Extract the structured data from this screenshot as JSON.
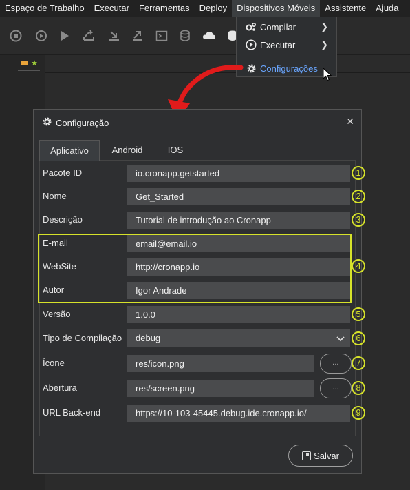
{
  "menubar": {
    "items": [
      "Espaço de Trabalho",
      "Executar",
      "Ferramentas",
      "Deploy",
      "Dispositivos Móveis",
      "Assistente",
      "Ajuda"
    ]
  },
  "toolbar": {
    "icons": [
      "stop-icon",
      "bug-icon",
      "play-icon",
      "export-icon",
      "import-icon",
      "share-icon",
      "terminal-icon",
      "database-icon",
      "cloud-icon",
      "database-cloud-icon"
    ]
  },
  "dropdown": {
    "compile": "Compilar",
    "execute": "Executar",
    "settings": "Configurações"
  },
  "dialog": {
    "title": "Configuração",
    "tabs": [
      "Aplicativo",
      "Android",
      "IOS"
    ],
    "fields": [
      {
        "label": "Pacote ID",
        "value": "io.cronapp.getstarted",
        "badge": "1"
      },
      {
        "label": "Nome",
        "value": "Get_Started",
        "badge": "2"
      },
      {
        "label": "Descrição",
        "value": "Tutorial de introdução ao Cronapp",
        "badge": "3"
      },
      {
        "label": "E-mail",
        "value": "email@email.io"
      },
      {
        "label": "WebSite",
        "value": "http://cronapp.io"
      },
      {
        "label": "Autor",
        "value": "Igor Andrade"
      },
      {
        "label": "Versão",
        "value": "1.0.0",
        "badge": "5"
      },
      {
        "label": "Tipo de Compilação",
        "value": "debug",
        "badge": "6"
      },
      {
        "label": "Ícone",
        "value": "res/icon.png",
        "badge": "7"
      },
      {
        "label": "Abertura",
        "value": "res/screen.png",
        "badge": "8"
      },
      {
        "label": "URL Back-end",
        "value": "https://10-103-45445.debug.ide.cronapp.io/",
        "badge": "9"
      }
    ],
    "group_badge": "4",
    "browse_label": "...",
    "save_label": "Salvar"
  },
  "colors": {
    "highlight": "#d6e22a",
    "link": "#6aa6ff",
    "arrow": "#e01b1b",
    "file_marker": "#e8a33a"
  }
}
